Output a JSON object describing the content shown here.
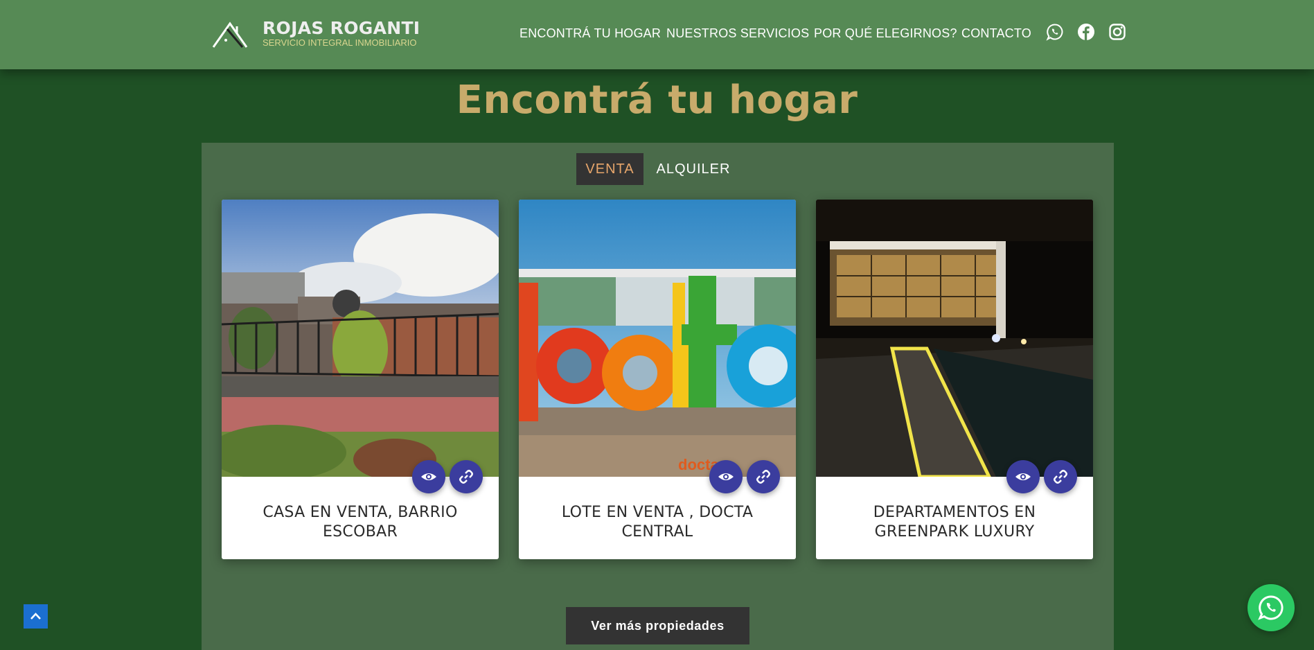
{
  "brand": {
    "name": "ROJAS ROGANTI",
    "tagline": "SERVICIO INTEGRAL INMOBILIARIO"
  },
  "nav": {
    "items": [
      {
        "label": "ENCONTRÁ TU HOGAR"
      },
      {
        "label": "NUESTROS SERVICIOS"
      },
      {
        "label": "POR QUÉ ELEGIRNOS?"
      },
      {
        "label": "CONTACTO"
      }
    ],
    "social_icons": [
      "whatsapp-icon",
      "facebook-icon",
      "instagram-icon"
    ]
  },
  "main": {
    "title": "Encontrá tu hogar",
    "tabs": [
      {
        "label": "VENTA",
        "active": true
      },
      {
        "label": "ALQUILER",
        "active": false
      }
    ],
    "listings": [
      {
        "title": "CASA EN VENTA, BARRIO ESCOBAR",
        "image": "house-photo"
      },
      {
        "title": "LOTE EN VENTA , DOCTA CENTRAL",
        "image": "docta-sign-photo"
      },
      {
        "title": "DEPARTAMENTOS EN GREENPARK LUXURY",
        "image": "greenpark-night-photo"
      }
    ],
    "more_button": "Ver más propiedades"
  },
  "colors": {
    "header": "#568a55",
    "background": "#1f5125",
    "panel": "#4a6b4a",
    "title": "#c8ab6b",
    "tab_active_text": "#e7a66b",
    "action_button": "#3b3d9e",
    "whatsapp": "#2bc963",
    "scroll_top": "#1b6fd0"
  }
}
